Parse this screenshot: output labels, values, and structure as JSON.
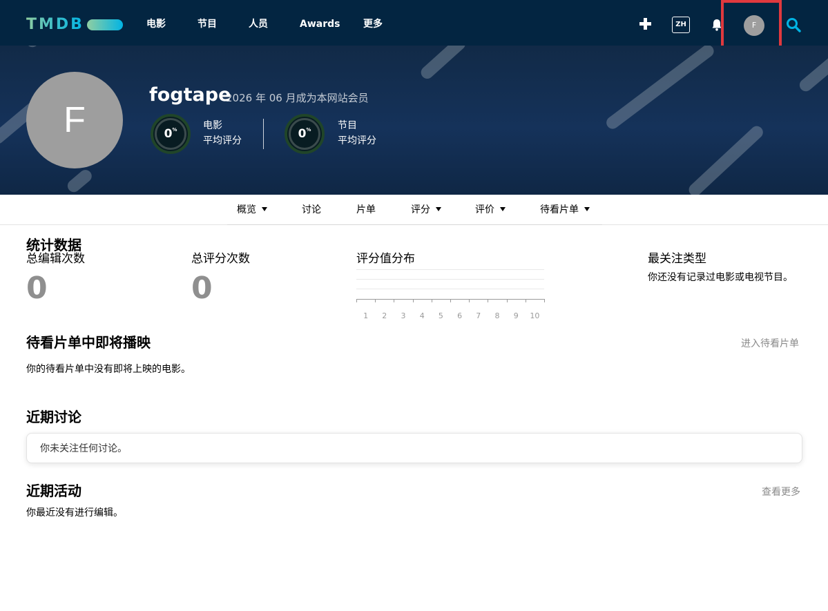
{
  "nav": {
    "logo": "TMDB",
    "items": [
      "电影",
      "节目",
      "人员",
      "Awards",
      "更多"
    ],
    "language": "ZH",
    "avatar_initial": "F"
  },
  "profile": {
    "avatar_initial": "F",
    "username": "fogtape",
    "member_since": "2026 年 06 月成为本网站会员",
    "scores": [
      {
        "value": "0",
        "unit": "%",
        "label_line1": "电影",
        "label_line2": "平均评分",
        "percent": 0
      },
      {
        "value": "0",
        "unit": "%",
        "label_line1": "节目",
        "label_line2": "平均评分",
        "percent": 0
      }
    ]
  },
  "subnav": {
    "items": [
      {
        "label": "概览",
        "dropdown": true
      },
      {
        "label": "讨论",
        "dropdown": false
      },
      {
        "label": "片单",
        "dropdown": false
      },
      {
        "label": "评分",
        "dropdown": true
      },
      {
        "label": "评价",
        "dropdown": true
      },
      {
        "label": "待看片单",
        "dropdown": true
      }
    ]
  },
  "stats": {
    "title": "统计数据",
    "total_edits_label": "总编辑次数",
    "total_edits_value": "0",
    "total_ratings_label": "总评分次数",
    "total_ratings_value": "0",
    "rating_dist_label": "评分值分布",
    "rating_dist_ticks": [
      "1",
      "2",
      "3",
      "4",
      "5",
      "6",
      "7",
      "8",
      "9",
      "10"
    ],
    "top_genres_label": "最关注类型",
    "top_genres_text": "你还没有记录过电影或电视节目。"
  },
  "upcoming": {
    "title": "待看片单中即将播映",
    "link": "进入待看片单",
    "text": "你的待看片单中没有即将上映的电影。"
  },
  "discussions": {
    "title": "近期讨论",
    "text": "你未关注任何讨论。"
  },
  "activity": {
    "title": "近期活动",
    "link": "查看更多",
    "text": "你最近没有进行编辑。"
  },
  "colors": {
    "nav_bg": "#032541",
    "highlight": "#e0393e",
    "avatar_gray": "#9e9e9e"
  }
}
